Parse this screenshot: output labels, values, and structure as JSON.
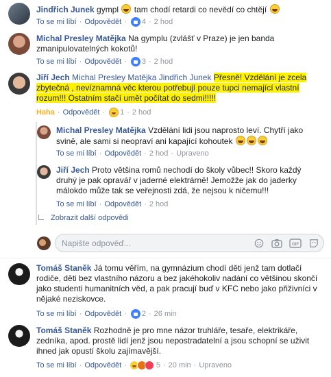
{
  "comments": [
    {
      "author": "Jindřich Junek",
      "text": "gympl",
      "text2": "tam chodí retardi co nevědí co chtějí",
      "like": "To se mi líbí",
      "reply": "Odpovědět",
      "count": "4",
      "time": "2 hod"
    },
    {
      "author": "Michal Presley Matějka",
      "text": "Na gymplu (zvlášť v Praze) je jen banda",
      "text_line2": "zmanipulovatelných kokotů!",
      "like": "To se mi líbí",
      "reply": "Odpovědět",
      "count": "3",
      "time": "2 hod"
    },
    {
      "author": "Jiří Jech",
      "tag1": "Michal Presley Matějka",
      "tag2": "Jindřich Junek",
      "hl_line1": "Přesně! Vzdělání je zcela",
      "hl_line2": "zbytečná , nevíznamná věc kterou potřebují pouze tupci nemající vlastní",
      "hl_line3": "rozum!!! Ostatním stačí umět počítat do sedmi!!!!!",
      "haha": "Haha",
      "reply": "Odpovědět",
      "count": "1",
      "time": "2 hod"
    }
  ],
  "replies": [
    {
      "author": "Michal Presley Matějka",
      "line1": "Vzdělání lidi jsou naprosto leví. Chytří jako",
      "line2": "svině, ale sami si neopraví ani kapající kohoutek",
      "like": "To se mi líbí",
      "reply": "Odpovědět",
      "time": "2 hod",
      "edited": "Upraveno"
    },
    {
      "author": "Jiří Jech",
      "line1": "Proto většina romů nechodí do školy vůbec!! Skoro každý",
      "line2": "druhý je pak opravář v jaderné elektrárně! Jemožže jak do jaderky",
      "line3": "málokdo může tak se veřejnosti zdá, že nejsou k ničemu!!!",
      "like": "To se mi líbí",
      "reply": "Odpovědět",
      "time": "2 hod"
    }
  ],
  "more_replies": "Zobrazit další odpovědi",
  "composer": {
    "placeholder": "Napište odpověď..."
  },
  "bottom": [
    {
      "author": "Tomáš Staněk",
      "line1": "Já tomu věřím, na gymnázium chodí děti jenž tam dotlačí",
      "line2": "rodiče, děti bez vlastního názoru a bez jakéhokoliv nadání co většinou skončí",
      "line3": "jako studenti humanitních věd, a pak pracují buď v KFC nebo jako přiživníci v",
      "line4": "nějaké neziskovce.",
      "like": "To se mi líbí",
      "reply": "Odpovědět",
      "count": "2",
      "time": "26 min"
    },
    {
      "author": "Tomáš Staněk",
      "line1": "Rozhodně je pro mne názor truhláře, tesaře, elektrikáře,",
      "line2": "zedníka, apod. prostě lidí jenž jsou nepostradatelní a jsou schopní se uživit",
      "line3": "ihned jak opustí školu zajímavější.",
      "like": "To se mi líbí",
      "reply": "Odpovědět",
      "count": "5",
      "time": "20 min",
      "edited": "Upraveno"
    }
  ],
  "colors": {
    "link": "#385898",
    "highlight": "#fff200",
    "haha": "#f7b125",
    "like": "#4080ff"
  },
  "icons": [
    "avatar",
    "haha-emoji",
    "like-icon",
    "haha-icon",
    "angry-icon",
    "love-icon",
    "reply-arrow-icon",
    "emoji-icon",
    "camera-icon",
    "gif-icon",
    "sticker-icon"
  ]
}
